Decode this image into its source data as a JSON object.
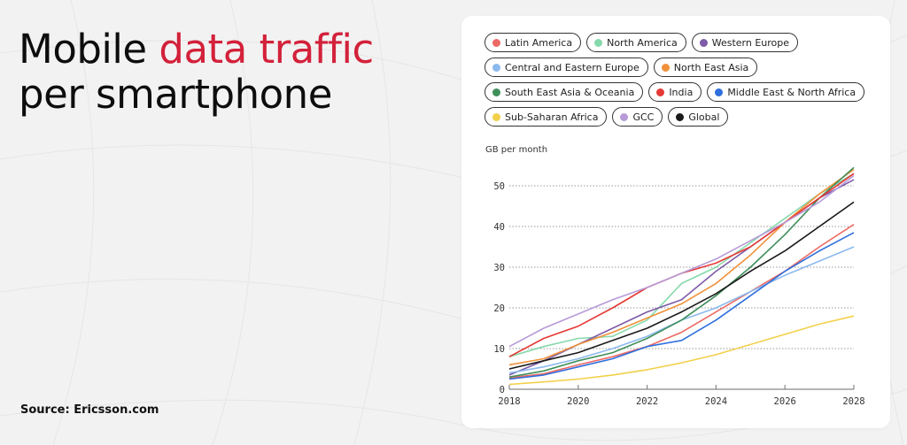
{
  "headline": {
    "part1": "Mobile ",
    "accent": "data traffic",
    "part2": "per smartphone"
  },
  "source": "Source: Ericsson.com",
  "colors": {
    "accent": "#d3213a",
    "background": "#f2f2f2",
    "card": "#ffffff"
  },
  "chart_data": {
    "type": "line",
    "title": "Mobile data traffic per smartphone",
    "ylabel": "GB per month",
    "xlabel": "",
    "x": [
      2018,
      2019,
      2020,
      2021,
      2022,
      2023,
      2024,
      2025,
      2026,
      2027,
      2028
    ],
    "xticks": [
      "2018",
      "2020",
      "2022",
      "2024",
      "2026",
      "2028"
    ],
    "yticks": [
      "0",
      "10",
      "20",
      "30",
      "40",
      "50"
    ],
    "ylim": [
      0,
      55
    ],
    "xlim": [
      2018,
      2028
    ],
    "grid": "horizontal dotted",
    "legend_position": "top",
    "series": [
      {
        "name": "Latin America",
        "color": "#ec6a64",
        "values": [
          2.8,
          3.8,
          6,
          8,
          10.5,
          14,
          19,
          24,
          29,
          35,
          40.5
        ]
      },
      {
        "name": "North America",
        "color": "#86d9ab",
        "values": [
          8,
          10.5,
          12.5,
          13,
          17,
          26,
          30,
          36,
          42,
          48,
          53
        ]
      },
      {
        "name": "Western Europe",
        "color": "#7e5ba8",
        "values": [
          3.5,
          7,
          11,
          15,
          19,
          22,
          29,
          35,
          41,
          47,
          51.5
        ]
      },
      {
        "name": "Central and Eastern Europe",
        "color": "#8cb9ee",
        "values": [
          4,
          5.5,
          7.5,
          10,
          13,
          17,
          20,
          24,
          28,
          31.5,
          35
        ]
      },
      {
        "name": "North East Asia",
        "color": "#f0913a",
        "values": [
          6,
          7.5,
          11,
          14,
          17.5,
          21,
          26,
          33,
          41,
          48,
          54
        ]
      },
      {
        "name": "South East Asia & Oceania",
        "color": "#3f8f5a",
        "values": [
          3,
          4.5,
          7,
          9,
          12.5,
          17,
          23,
          30,
          38,
          47,
          54.5
        ]
      },
      {
        "name": "India",
        "color": "#e53935",
        "values": [
          8,
          12.5,
          15.5,
          20,
          25,
          28.5,
          31,
          35,
          41,
          47,
          53
        ]
      },
      {
        "name": "Middle East & North Africa",
        "color": "#2f6fdc",
        "values": [
          2.5,
          3.5,
          5.5,
          7.5,
          10.5,
          12,
          17,
          23,
          29,
          34,
          38.5
        ]
      },
      {
        "name": "Sub-Saharan Africa",
        "color": "#f2d04a",
        "values": [
          1.2,
          1.8,
          2.5,
          3.5,
          4.8,
          6.5,
          8.5,
          11,
          13.5,
          16,
          18
        ]
      },
      {
        "name": "GCC",
        "color": "#b79ad8",
        "values": [
          10.5,
          15,
          18.5,
          22,
          25,
          28.5,
          32,
          36.5,
          41,
          46,
          52.5
        ]
      },
      {
        "name": "Global",
        "color": "#1a1a1a",
        "values": [
          5,
          7,
          9,
          12,
          15,
          19,
          23.5,
          29,
          34,
          40,
          46
        ]
      }
    ]
  }
}
